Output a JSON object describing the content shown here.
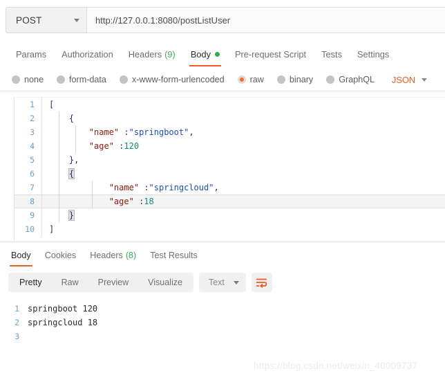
{
  "request": {
    "method": "POST",
    "url": "http://127.0.0.1:8080/postListUser",
    "tabs": [
      {
        "label": "Params",
        "active": false
      },
      {
        "label": "Authorization",
        "active": false
      },
      {
        "label": "Headers",
        "count": "(9)",
        "active": false
      },
      {
        "label": "Body",
        "active": true,
        "dot": true
      },
      {
        "label": "Pre-request Script",
        "active": false
      },
      {
        "label": "Tests",
        "active": false
      },
      {
        "label": "Settings",
        "active": false
      }
    ],
    "body_types": [
      {
        "label": "none",
        "selected": false
      },
      {
        "label": "form-data",
        "selected": false
      },
      {
        "label": "x-www-form-urlencoded",
        "selected": false
      },
      {
        "label": "raw",
        "selected": true
      },
      {
        "label": "binary",
        "selected": false
      },
      {
        "label": "GraphQL",
        "selected": false
      }
    ],
    "format": "JSON",
    "editor_lines": [
      {
        "no": "1",
        "text": "["
      },
      {
        "no": "2",
        "text": "    {"
      },
      {
        "no": "3",
        "text": "        \"name\" :\"springboot\","
      },
      {
        "no": "4",
        "text": "        \"age\" :120"
      },
      {
        "no": "5",
        "text": "    },"
      },
      {
        "no": "6",
        "text": "    {"
      },
      {
        "no": "7",
        "text": "            \"name\" :\"springcloud\","
      },
      {
        "no": "8",
        "text": "            \"age\" :18"
      },
      {
        "no": "9",
        "text": "    }"
      },
      {
        "no": "10",
        "text": "]"
      }
    ]
  },
  "response": {
    "tabs": [
      {
        "label": "Body",
        "active": true
      },
      {
        "label": "Cookies",
        "active": false
      },
      {
        "label": "Headers",
        "count": "(8)",
        "active": false
      },
      {
        "label": "Test Results",
        "active": false
      }
    ],
    "views": [
      {
        "label": "Pretty",
        "active": true
      },
      {
        "label": "Raw",
        "active": false
      },
      {
        "label": "Preview",
        "active": false
      },
      {
        "label": "Visualize",
        "active": false
      }
    ],
    "format": "Text",
    "wrap_icon": "word-wrap-icon",
    "body_lines": [
      {
        "no": "1",
        "text": "springboot 120"
      },
      {
        "no": "2",
        "text": "springcloud 18"
      },
      {
        "no": "3",
        "text": ""
      }
    ]
  },
  "watermark": "https://blog.csdn.net/weixin_40009737",
  "colors": {
    "accent": "#ef5b25",
    "green": "#30aa4c",
    "json_key": "#8b1a10",
    "json_string": "#1a4fb5",
    "json_number": "#0f8a7e",
    "line_number": "#6aa0c8"
  }
}
